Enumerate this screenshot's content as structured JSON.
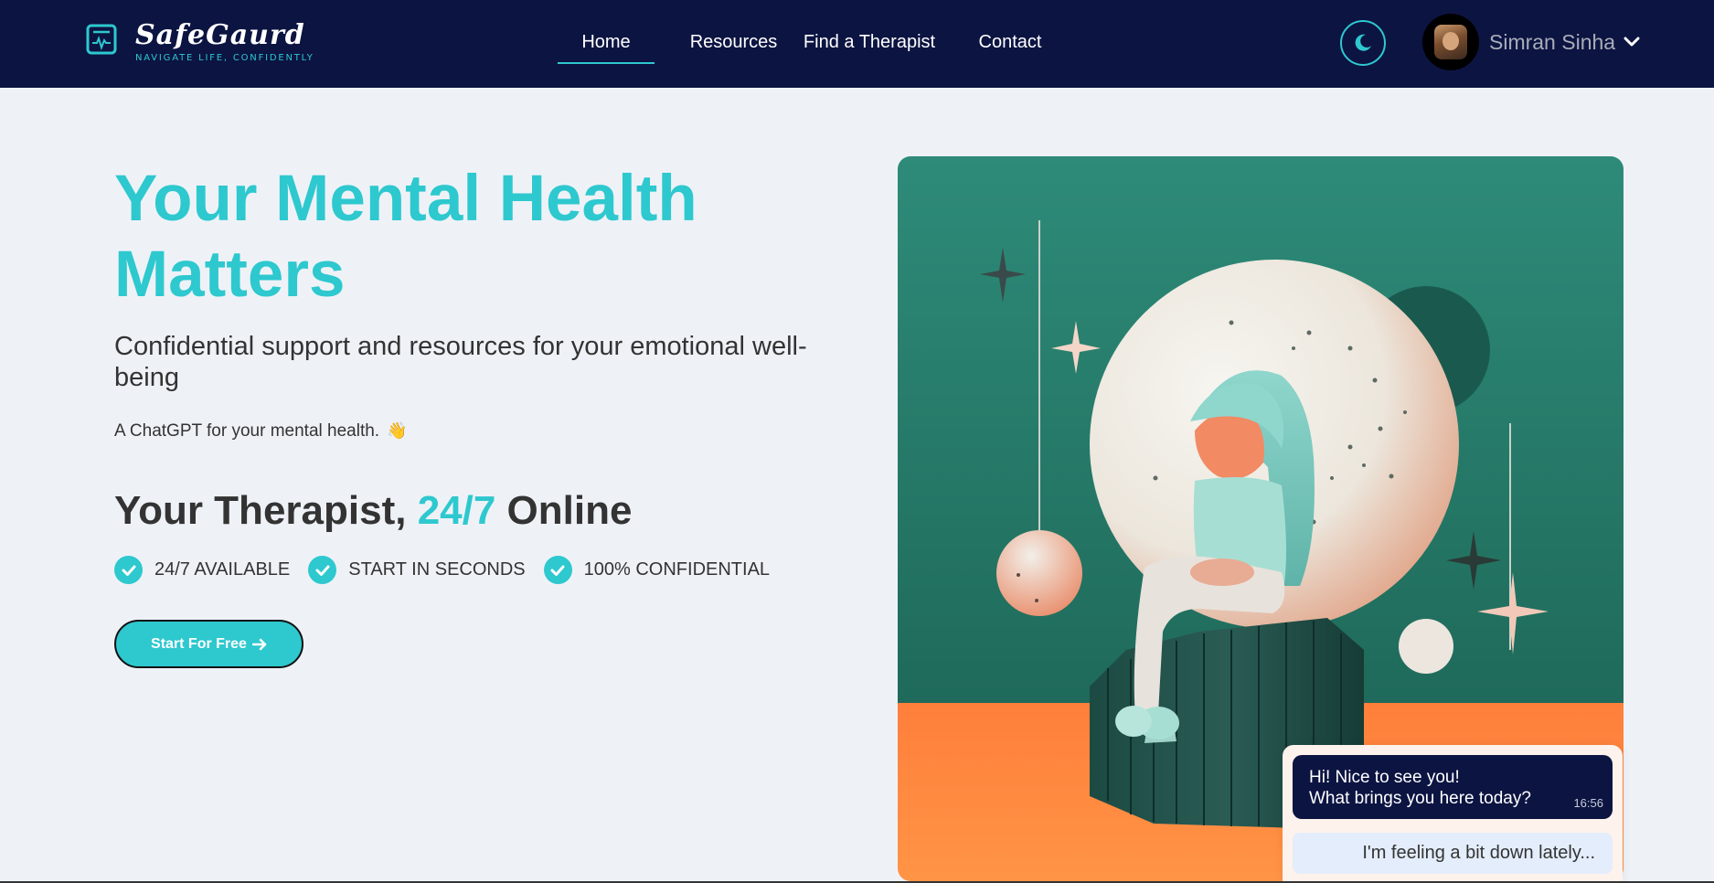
{
  "brand": {
    "name": "SafeGaurd",
    "tagline": "NAVIGATE LIFE, CONFIDENTLY",
    "logo_icon": "heartbeat-monitor-icon"
  },
  "nav": {
    "items": [
      {
        "label": "Home",
        "active": true
      },
      {
        "label": "Resources",
        "active": false
      },
      {
        "label": "Find a Therapist",
        "active": false
      },
      {
        "label": "Contact",
        "active": false
      }
    ],
    "theme_toggle_icon": "moon-icon"
  },
  "user": {
    "name": "Simran Sinha",
    "menu_icon": "chevron-down-icon"
  },
  "hero": {
    "title": "Your Mental Health Matters",
    "subtitle": "Confidential support and resources for your emotional well-being",
    "tagline": "A ChatGPT for your mental health.",
    "tagline_emoji": "👋",
    "therapist_heading": {
      "prefix": "Your Therapist, ",
      "highlight": "24/7",
      "suffix": " Online"
    },
    "features": [
      "24/7 AVAILABLE",
      "START IN SECONDS",
      "100% CONFIDENTIAL"
    ],
    "cta": "Start For Free"
  },
  "chat": {
    "bot_message": {
      "line1": "Hi! Nice to see you!",
      "line2": "What brings you here today?",
      "time": "16:56"
    },
    "user_message": "I'm feeling a bit down lately..."
  },
  "colors": {
    "navy": "#0c1442",
    "accent": "#2ec8cf",
    "background": "#eef2f7",
    "illustration_teal": "#2a8a78",
    "illustration_orange": "#ff8a3d"
  }
}
